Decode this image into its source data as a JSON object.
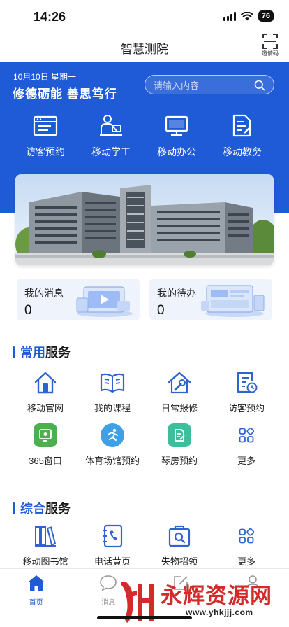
{
  "status": {
    "time": "14:26",
    "battery": "76"
  },
  "nav": {
    "title": "智慧测院",
    "invite_label": "邀请码"
  },
  "hero": {
    "date": "10月10日 星期一",
    "motto": "修德砺能  善思笃行",
    "search_placeholder": "请输入内容",
    "quick": [
      {
        "label": "访客预约",
        "icon": "visitor-form-icon"
      },
      {
        "label": "移动学工",
        "icon": "student-work-icon"
      },
      {
        "label": "移动办公",
        "icon": "computer-monitor-icon"
      },
      {
        "label": "移动教务",
        "icon": "document-edit-icon"
      }
    ]
  },
  "cards": {
    "messages": {
      "title": "我的消息",
      "count": "0"
    },
    "todos": {
      "title": "我的待办",
      "count": "0"
    }
  },
  "common": {
    "title_highlight": "常用",
    "title_rest": "服务",
    "items": [
      {
        "label": "移动官网",
        "icon": "home-icon"
      },
      {
        "label": "我的课程",
        "icon": "book-icon"
      },
      {
        "label": "日常报修",
        "icon": "repair-icon"
      },
      {
        "label": "访客预约",
        "icon": "calendar-doc-icon"
      },
      {
        "label": "365窗口",
        "icon": "window-365-icon"
      },
      {
        "label": "体育场馆预约",
        "icon": "sports-icon"
      },
      {
        "label": "琴房预约",
        "icon": "piano-room-icon"
      },
      {
        "label": "更多",
        "icon": "more-grid-icon"
      }
    ]
  },
  "general": {
    "title_highlight": "综合",
    "title_rest": "服务",
    "items": [
      {
        "label": "移动图书馆",
        "icon": "library-icon"
      },
      {
        "label": "电话黄页",
        "icon": "phone-book-icon"
      },
      {
        "label": "失物招领",
        "icon": "lost-found-icon"
      },
      {
        "label": "更多",
        "icon": "more-grid-icon"
      }
    ]
  },
  "tabs": [
    {
      "label": "首页",
      "icon": "home-tab-icon",
      "active": true
    },
    {
      "label": "消息",
      "icon": "message-tab-icon",
      "active": false
    },
    {
      "label": "",
      "icon": "edit-tab-icon",
      "active": false
    },
    {
      "label": "",
      "icon": "user-tab-icon",
      "active": false
    }
  ],
  "watermark": {
    "brand": "永辉资源网",
    "url": "www.yhkjjj.com"
  },
  "colors": {
    "primary": "#1f5bd7",
    "card_bg": "#eef3fc",
    "green": "#4caf50",
    "sky": "#3fa0e8",
    "teal": "#3cbf9c",
    "watermark_red": "#d42a2a"
  }
}
